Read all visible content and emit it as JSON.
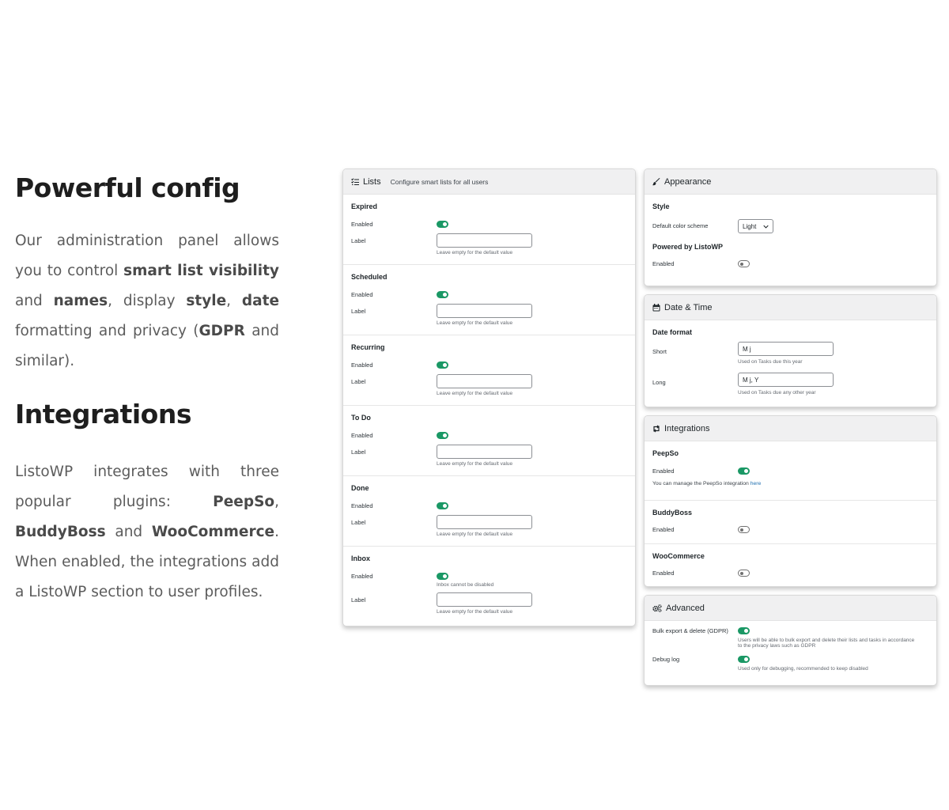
{
  "copy": {
    "heading_config": "Powerful config",
    "config_paragraph": [
      {
        "t": "Our administration panel allows you to control ",
        "b": false
      },
      {
        "t": "smart list visibility",
        "b": true
      },
      {
        "t": " and ",
        "b": false
      },
      {
        "t": "names",
        "b": true
      },
      {
        "t": ", display ",
        "b": false
      },
      {
        "t": "style",
        "b": true
      },
      {
        "t": ", ",
        "b": false
      },
      {
        "t": "date",
        "b": true
      },
      {
        "t": " formatting and privacy (",
        "b": false
      },
      {
        "t": "GDPR",
        "b": true
      },
      {
        "t": " and similar).",
        "b": false
      }
    ],
    "heading_integrations": "Integrations",
    "integrations_paragraph": [
      {
        "t": "ListoWP integrates with three popular plugins: ",
        "b": false
      },
      {
        "t": "PeepSo",
        "b": true
      },
      {
        "t": ", ",
        "b": false
      },
      {
        "t": "BuddyBoss",
        "b": true
      },
      {
        "t": " and ",
        "b": false
      },
      {
        "t": "WooCommerce",
        "b": true
      },
      {
        "t": ". When enabled, the integrations add a ListoWP section to user profiles.",
        "b": false
      }
    ]
  },
  "lists_panel": {
    "icon": "list-checks-icon",
    "title": "Lists",
    "subtitle": "Configure smart lists for all users",
    "enabled_label": "Enabled",
    "label_label": "Label",
    "help_default": "Leave empty for the default value",
    "items": [
      {
        "name": "Expired",
        "enabled": true,
        "label_value": ""
      },
      {
        "name": "Scheduled",
        "enabled": true,
        "label_value": ""
      },
      {
        "name": "Recurring",
        "enabled": true,
        "label_value": ""
      },
      {
        "name": "To Do",
        "enabled": true,
        "label_value": ""
      },
      {
        "name": "Done",
        "enabled": true,
        "label_value": ""
      },
      {
        "name": "Inbox",
        "enabled": true,
        "label_value": "",
        "enabled_help": "Inbox cannot be disabled"
      }
    ]
  },
  "appearance_panel": {
    "icon": "paintbrush-icon",
    "title": "Appearance",
    "style_title": "Style",
    "color_scheme_label": "Default color scheme",
    "color_scheme_value": "Light",
    "powered_title": "Powered by ListoWP",
    "powered_enabled_label": "Enabled",
    "powered_enabled": false
  },
  "datetime_panel": {
    "icon": "calendar-icon",
    "title": "Date & Time",
    "format_title": "Date format",
    "short_label": "Short",
    "short_value": "M j",
    "short_help": "Used on Tasks due this year",
    "long_label": "Long",
    "long_value": "M j, Y",
    "long_help": "Used on Tasks due any other year"
  },
  "integrations_panel": {
    "icon": "sync-arrows-icon",
    "title": "Integrations",
    "peepso_title": "PeepSo",
    "peepso_enabled_label": "Enabled",
    "peepso_enabled": true,
    "peepso_help": "You can manage the PeepSo integration",
    "peepso_link": "here",
    "buddyboss_title": "BuddyBoss",
    "buddyboss_enabled_label": "Enabled",
    "buddyboss_enabled": false,
    "woo_title": "WooCommerce",
    "woo_enabled_label": "Enabled",
    "woo_enabled": false
  },
  "advanced_panel": {
    "icon": "gears-icon",
    "title": "Advanced",
    "bulk_label": "Bulk export & delete (GDPR)",
    "bulk_enabled": true,
    "bulk_help_1": "Users will be able to bulk export and delete their lists and tasks in accordance",
    "bulk_help_2": "to the privacy laws such as GDPR",
    "debug_label": "Debug log",
    "debug_enabled": true,
    "debug_help": "Used only for debugging, recommended to keep disabled"
  },
  "colors": {
    "toggle_on": "#1a9865",
    "panel_header": "#f0f0f1",
    "link": "#2271b1"
  }
}
